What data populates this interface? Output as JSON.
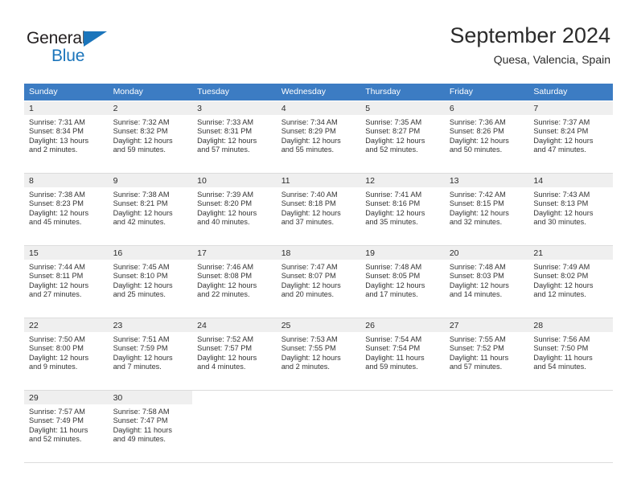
{
  "brand": {
    "name_top": "General",
    "name_bottom": "Blue",
    "triangle_color": "#1b75bb"
  },
  "header": {
    "title": "September 2024",
    "subtitle": "Quesa, Valencia, Spain"
  },
  "colors": {
    "header_blue": "#3c7cc3",
    "daynum_band": "#efefef",
    "row_divider": "#dcdcdc",
    "text": "#333333"
  },
  "weekday_headers": [
    "Sunday",
    "Monday",
    "Tuesday",
    "Wednesday",
    "Thursday",
    "Friday",
    "Saturday"
  ],
  "labels": {
    "sunrise_prefix": "Sunrise:",
    "sunset_prefix": "Sunset:",
    "daylight_prefix": "Daylight:"
  },
  "days": [
    {
      "num": "1",
      "sunrise": "Sunrise: 7:31 AM",
      "sunset": "Sunset: 8:34 PM",
      "daylight_1": "Daylight: 13 hours",
      "daylight_2": "and 2 minutes."
    },
    {
      "num": "2",
      "sunrise": "Sunrise: 7:32 AM",
      "sunset": "Sunset: 8:32 PM",
      "daylight_1": "Daylight: 12 hours",
      "daylight_2": "and 59 minutes."
    },
    {
      "num": "3",
      "sunrise": "Sunrise: 7:33 AM",
      "sunset": "Sunset: 8:31 PM",
      "daylight_1": "Daylight: 12 hours",
      "daylight_2": "and 57 minutes."
    },
    {
      "num": "4",
      "sunrise": "Sunrise: 7:34 AM",
      "sunset": "Sunset: 8:29 PM",
      "daylight_1": "Daylight: 12 hours",
      "daylight_2": "and 55 minutes."
    },
    {
      "num": "5",
      "sunrise": "Sunrise: 7:35 AM",
      "sunset": "Sunset: 8:27 PM",
      "daylight_1": "Daylight: 12 hours",
      "daylight_2": "and 52 minutes."
    },
    {
      "num": "6",
      "sunrise": "Sunrise: 7:36 AM",
      "sunset": "Sunset: 8:26 PM",
      "daylight_1": "Daylight: 12 hours",
      "daylight_2": "and 50 minutes."
    },
    {
      "num": "7",
      "sunrise": "Sunrise: 7:37 AM",
      "sunset": "Sunset: 8:24 PM",
      "daylight_1": "Daylight: 12 hours",
      "daylight_2": "and 47 minutes."
    },
    {
      "num": "8",
      "sunrise": "Sunrise: 7:38 AM",
      "sunset": "Sunset: 8:23 PM",
      "daylight_1": "Daylight: 12 hours",
      "daylight_2": "and 45 minutes."
    },
    {
      "num": "9",
      "sunrise": "Sunrise: 7:38 AM",
      "sunset": "Sunset: 8:21 PM",
      "daylight_1": "Daylight: 12 hours",
      "daylight_2": "and 42 minutes."
    },
    {
      "num": "10",
      "sunrise": "Sunrise: 7:39 AM",
      "sunset": "Sunset: 8:20 PM",
      "daylight_1": "Daylight: 12 hours",
      "daylight_2": "and 40 minutes."
    },
    {
      "num": "11",
      "sunrise": "Sunrise: 7:40 AM",
      "sunset": "Sunset: 8:18 PM",
      "daylight_1": "Daylight: 12 hours",
      "daylight_2": "and 37 minutes."
    },
    {
      "num": "12",
      "sunrise": "Sunrise: 7:41 AM",
      "sunset": "Sunset: 8:16 PM",
      "daylight_1": "Daylight: 12 hours",
      "daylight_2": "and 35 minutes."
    },
    {
      "num": "13",
      "sunrise": "Sunrise: 7:42 AM",
      "sunset": "Sunset: 8:15 PM",
      "daylight_1": "Daylight: 12 hours",
      "daylight_2": "and 32 minutes."
    },
    {
      "num": "14",
      "sunrise": "Sunrise: 7:43 AM",
      "sunset": "Sunset: 8:13 PM",
      "daylight_1": "Daylight: 12 hours",
      "daylight_2": "and 30 minutes."
    },
    {
      "num": "15",
      "sunrise": "Sunrise: 7:44 AM",
      "sunset": "Sunset: 8:11 PM",
      "daylight_1": "Daylight: 12 hours",
      "daylight_2": "and 27 minutes."
    },
    {
      "num": "16",
      "sunrise": "Sunrise: 7:45 AM",
      "sunset": "Sunset: 8:10 PM",
      "daylight_1": "Daylight: 12 hours",
      "daylight_2": "and 25 minutes."
    },
    {
      "num": "17",
      "sunrise": "Sunrise: 7:46 AM",
      "sunset": "Sunset: 8:08 PM",
      "daylight_1": "Daylight: 12 hours",
      "daylight_2": "and 22 minutes."
    },
    {
      "num": "18",
      "sunrise": "Sunrise: 7:47 AM",
      "sunset": "Sunset: 8:07 PM",
      "daylight_1": "Daylight: 12 hours",
      "daylight_2": "and 20 minutes."
    },
    {
      "num": "19",
      "sunrise": "Sunrise: 7:48 AM",
      "sunset": "Sunset: 8:05 PM",
      "daylight_1": "Daylight: 12 hours",
      "daylight_2": "and 17 minutes."
    },
    {
      "num": "20",
      "sunrise": "Sunrise: 7:48 AM",
      "sunset": "Sunset: 8:03 PM",
      "daylight_1": "Daylight: 12 hours",
      "daylight_2": "and 14 minutes."
    },
    {
      "num": "21",
      "sunrise": "Sunrise: 7:49 AM",
      "sunset": "Sunset: 8:02 PM",
      "daylight_1": "Daylight: 12 hours",
      "daylight_2": "and 12 minutes."
    },
    {
      "num": "22",
      "sunrise": "Sunrise: 7:50 AM",
      "sunset": "Sunset: 8:00 PM",
      "daylight_1": "Daylight: 12 hours",
      "daylight_2": "and 9 minutes."
    },
    {
      "num": "23",
      "sunrise": "Sunrise: 7:51 AM",
      "sunset": "Sunset: 7:59 PM",
      "daylight_1": "Daylight: 12 hours",
      "daylight_2": "and 7 minutes."
    },
    {
      "num": "24",
      "sunrise": "Sunrise: 7:52 AM",
      "sunset": "Sunset: 7:57 PM",
      "daylight_1": "Daylight: 12 hours",
      "daylight_2": "and 4 minutes."
    },
    {
      "num": "25",
      "sunrise": "Sunrise: 7:53 AM",
      "sunset": "Sunset: 7:55 PM",
      "daylight_1": "Daylight: 12 hours",
      "daylight_2": "and 2 minutes."
    },
    {
      "num": "26",
      "sunrise": "Sunrise: 7:54 AM",
      "sunset": "Sunset: 7:54 PM",
      "daylight_1": "Daylight: 11 hours",
      "daylight_2": "and 59 minutes."
    },
    {
      "num": "27",
      "sunrise": "Sunrise: 7:55 AM",
      "sunset": "Sunset: 7:52 PM",
      "daylight_1": "Daylight: 11 hours",
      "daylight_2": "and 57 minutes."
    },
    {
      "num": "28",
      "sunrise": "Sunrise: 7:56 AM",
      "sunset": "Sunset: 7:50 PM",
      "daylight_1": "Daylight: 11 hours",
      "daylight_2": "and 54 minutes."
    },
    {
      "num": "29",
      "sunrise": "Sunrise: 7:57 AM",
      "sunset": "Sunset: 7:49 PM",
      "daylight_1": "Daylight: 11 hours",
      "daylight_2": "and 52 minutes."
    },
    {
      "num": "30",
      "sunrise": "Sunrise: 7:58 AM",
      "sunset": "Sunset: 7:47 PM",
      "daylight_1": "Daylight: 11 hours",
      "daylight_2": "and 49 minutes."
    }
  ],
  "grid": {
    "leading_blanks": 0,
    "trailing_blanks": 5,
    "weeks": 5
  }
}
